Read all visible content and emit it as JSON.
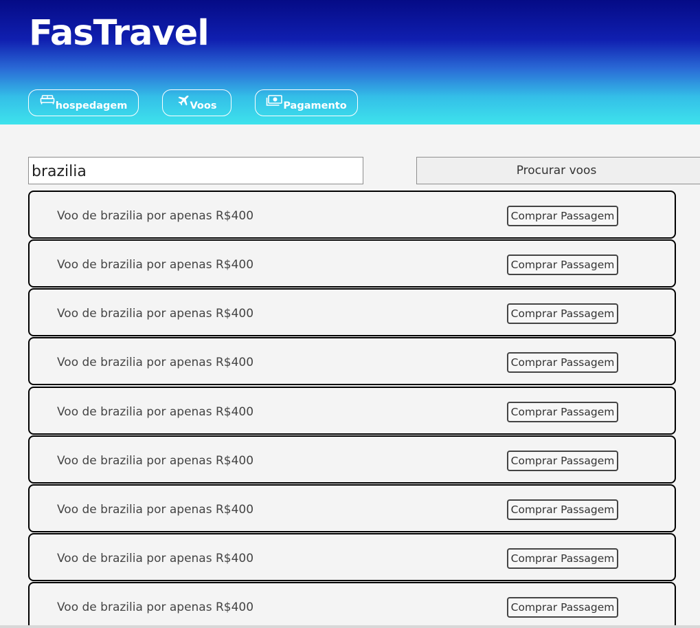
{
  "app": {
    "title": "FasTravel"
  },
  "nav": [
    {
      "label": "hospedagem",
      "icon": "bed-icon"
    },
    {
      "label": "Voos",
      "icon": "airplane-icon"
    },
    {
      "label": "Pagamento",
      "icon": "money-icon"
    }
  ],
  "search": {
    "value": "brazilia",
    "button_label": "Procurar voos"
  },
  "results": [
    {
      "text": "Voo de brazilia por apenas R$400",
      "button": "Comprar Passagem"
    },
    {
      "text": "Voo de brazilia por apenas R$400",
      "button": "Comprar Passagem"
    },
    {
      "text": "Voo de brazilia por apenas R$400",
      "button": "Comprar Passagem"
    },
    {
      "text": "Voo de brazilia por apenas R$400",
      "button": "Comprar Passagem"
    },
    {
      "text": "Voo de brazilia por apenas R$400",
      "button": "Comprar Passagem"
    },
    {
      "text": "Voo de brazilia por apenas R$400",
      "button": "Comprar Passagem"
    },
    {
      "text": "Voo de brazilia por apenas R$400",
      "button": "Comprar Passagem"
    },
    {
      "text": "Voo de brazilia por apenas R$400",
      "button": "Comprar Passagem"
    },
    {
      "text": "Voo de brazilia por apenas R$400",
      "button": "Comprar Passagem"
    }
  ],
  "colors": {
    "header_top": "#050b86",
    "header_bottom": "#3ee3ec",
    "page_bg": "#f4f4f4"
  }
}
